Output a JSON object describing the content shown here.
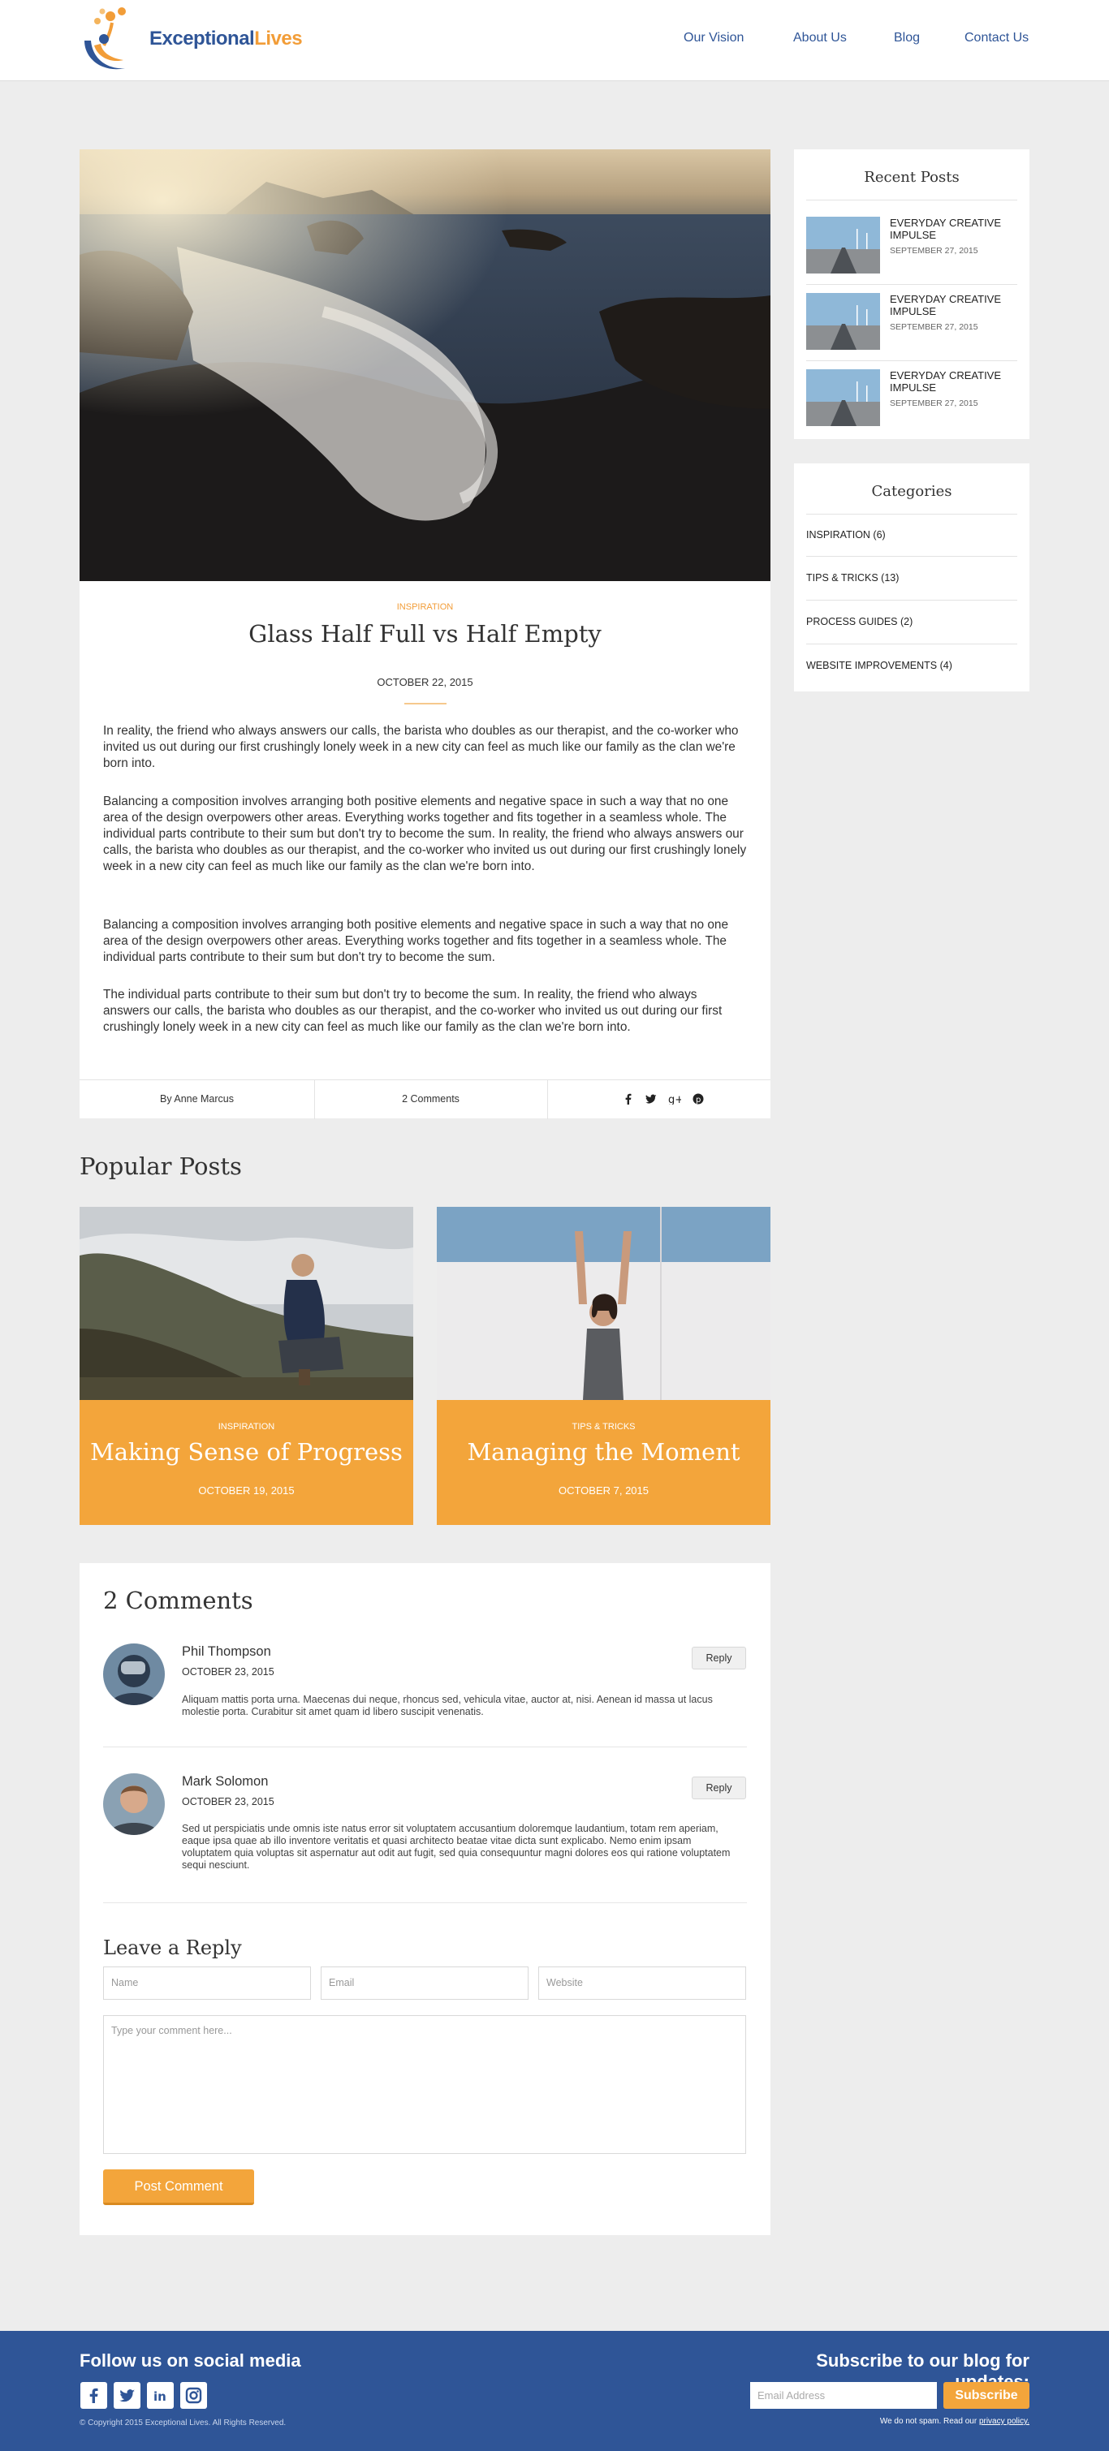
{
  "brand": {
    "name_part1": "Exceptional",
    "name_part2": "Lives"
  },
  "nav": [
    {
      "label": "Our Vision"
    },
    {
      "label": "About Us"
    },
    {
      "label": "Blog"
    },
    {
      "label": "Contact Us"
    }
  ],
  "post": {
    "category": "INSPIRATION",
    "title": "Glass Half Full vs Half Empty",
    "date": "OCTOBER 22, 2015",
    "paragraphs": [
      "In reality, the friend who always answers our calls, the barista who doubles as our therapist, and the co-worker who invited us out during our first crushingly lonely week in a new city can feel as much like our family as the clan we're born into.",
      "Balancing a composition involves arranging both positive elements and negative space in such a way that no one area of the design overpowers other areas. Everything works together and fits together in a seamless whole. The individual parts contribute to their sum but don't try to become the sum. In reality, the friend who always answers our calls, the barista who doubles as our therapist, and the co-worker who invited us out during our first crushingly lonely week in a new city can feel as much like our family as the clan we're born into.",
      "Balancing a composition involves arranging both positive elements and negative space in such a way that no one area of the design overpowers other areas. Everything works together and fits together in a seamless whole. The individual parts contribute to their sum but don't try to become the sum.",
      "The individual parts contribute to their sum but don't try to become the sum. In reality, the friend who always answers our calls, the barista who doubles as our therapist, and the co-worker who invited us out during our first crushingly lonely week in a new city can feel as much like our family as the clan we're born into."
    ],
    "author": "By Anne Marcus",
    "comments_count": "2 Comments",
    "share_icons": [
      "facebook-icon",
      "twitter-icon",
      "google-plus-icon",
      "pinterest-icon"
    ]
  },
  "popular": {
    "heading": "Popular Posts",
    "items": [
      {
        "category": "INSPIRATION",
        "title": "Making Sense of Progress",
        "date": "OCTOBER 19, 2015"
      },
      {
        "category": "TIPS & TRICKS",
        "title": "Managing the Moment",
        "date": "OCTOBER 7, 2015"
      }
    ]
  },
  "comments": {
    "heading": "2 Comments",
    "items": [
      {
        "name": "Phil Thompson",
        "date": "OCTOBER 23, 2015",
        "text": "Aliquam mattis porta urna. Maecenas dui neque, rhoncus sed, vehicula vitae, auctor at, nisi. Aenean id massa ut lacus molestie porta. Curabitur sit amet quam id libero suscipit venenatis.",
        "reply": "Reply"
      },
      {
        "name": "Mark Solomon",
        "date": "OCTOBER 23, 2015",
        "text": "Sed ut perspiciatis unde omnis iste natus error sit voluptatem accusantium doloremque laudantium, totam rem aperiam, eaque ipsa quae ab illo inventore veritatis et quasi architecto beatae vitae dicta sunt explicabo. Nemo enim ipsam voluptatem quia voluptas sit aspernatur aut odit aut fugit, sed quia consequuntur magni dolores eos qui ratione voluptatem sequi nesciunt.",
        "reply": "Reply"
      }
    ],
    "form": {
      "heading": "Leave a Reply",
      "name_placeholder": "Name",
      "email_placeholder": "Email",
      "website_placeholder": "Website",
      "comment_placeholder": "Type your comment here...",
      "submit": "Post Comment"
    }
  },
  "sidebar": {
    "recent": {
      "heading": "Recent Posts",
      "items": [
        {
          "title": "EVERYDAY CREATIVE IMPULSE",
          "date": "SEPTEMBER 27, 2015"
        },
        {
          "title": "EVERYDAY CREATIVE IMPULSE",
          "date": "SEPTEMBER 27, 2015"
        },
        {
          "title": "EVERYDAY CREATIVE IMPULSE",
          "date": "SEPTEMBER 27, 2015"
        }
      ]
    },
    "categories": {
      "heading": "Categories",
      "items": [
        {
          "label": "INSPIRATION (6)"
        },
        {
          "label": "TIPS & TRICKS (13)"
        },
        {
          "label": "PROCESS GUIDES (2)"
        },
        {
          "label": "WEBSITE IMPROVEMENTS (4)"
        }
      ]
    }
  },
  "footer": {
    "follow": "Follow us on social media",
    "social_icons": [
      "facebook-icon",
      "twitter-icon",
      "linkedin-icon",
      "instagram-icon"
    ],
    "copyright": "© Copyright 2015 Exceptional Lives. All Rights Reserved.",
    "subscribe_heading": "Subscribe to our blog for updates:",
    "email_placeholder": "Email Address",
    "subscribe_button": "Subscribe",
    "spam_text": "We do not spam. Read our",
    "privacy_link": "privacy policy."
  },
  "colors": {
    "accent": "#f3a53b",
    "brand_blue": "#2f5597",
    "background": "#ededed"
  }
}
